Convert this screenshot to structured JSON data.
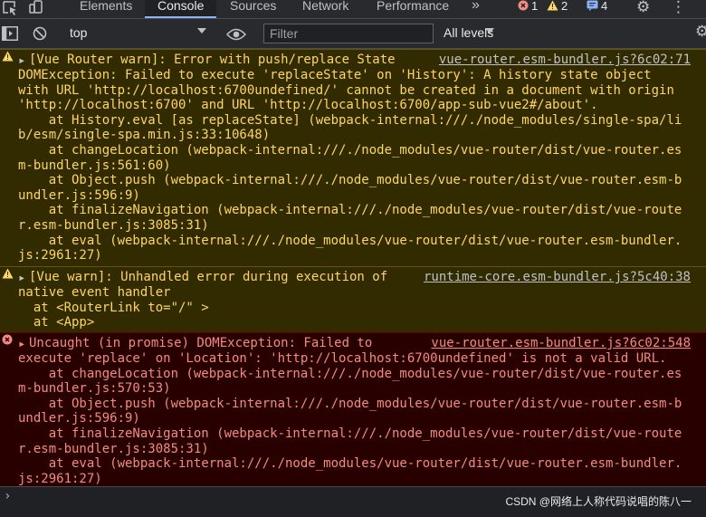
{
  "tabs": [
    "Elements",
    "Console",
    "Sources",
    "Network",
    "Performance"
  ],
  "overflow": "»",
  "counts": {
    "errors": "1",
    "warnings": "2",
    "info": "4"
  },
  "toolbar": {
    "context": "top",
    "filter_placeholder": "Filter",
    "levels": "All levels"
  },
  "msg1": {
    "src": "vue-router.esm-bundler.js?6c02:71",
    "lines": [
      "[Vue Router warn]: Error with push/replace State",
      "DOMException: Failed to execute 'replaceState' on 'History': A history state object",
      "with URL 'http://localhost:6700undefined/' cannot be created in a document with origin",
      "'http://localhost:6700' and URL 'http://localhost:6700/app-sub-vue2#/about'.",
      "    at History.eval [as replaceState] (webpack-internal:///./node_modules/single-spa/li",
      "b/esm/single-spa.min.js:33:10648)",
      "    at changeLocation (webpack-internal:///./node_modules/vue-router/dist/vue-router.es",
      "m-bundler.js:561:60)",
      "    at Object.push (webpack-internal:///./node_modules/vue-router/dist/vue-router.esm-b",
      "undler.js:596:9)",
      "    at finalizeNavigation (webpack-internal:///./node_modules/vue-router/dist/vue-route",
      "r.esm-bundler.js:3085:31)",
      "    at eval (webpack-internal:///./node_modules/vue-router/dist/vue-router.esm-bundler.",
      "js:2961:27)"
    ]
  },
  "msg2": {
    "src": "runtime-core.esm-bundler.js?5c40:38",
    "lines": [
      "[Vue warn]: Unhandled error during execution of",
      "native event handler",
      "  at <RouterLink to=\"/\" >",
      "  at <App>"
    ]
  },
  "msg3": {
    "src": "vue-router.esm-bundler.js?6c02:548",
    "lines": [
      "Uncaught (in promise) DOMException: Failed to",
      "execute 'replace' on 'Location': 'http://localhost:6700undefined' is not a valid URL.",
      "    at changeLocation (webpack-internal:///./node_modules/vue-router/dist/vue-router.es",
      "m-bundler.js:570:53)",
      "    at Object.push (webpack-internal:///./node_modules/vue-router/dist/vue-router.esm-b",
      "undler.js:596:9)",
      "    at finalizeNavigation (webpack-internal:///./node_modules/vue-router/dist/vue-route",
      "r.esm-bundler.js:3085:31)",
      "    at eval (webpack-internal:///./node_modules/vue-router/dist/vue-router.esm-bundler.",
      "js:2961:27)"
    ]
  },
  "prompt_caret": "›",
  "watermark": "CSDN @网络上人称代码说唱的陈八一"
}
